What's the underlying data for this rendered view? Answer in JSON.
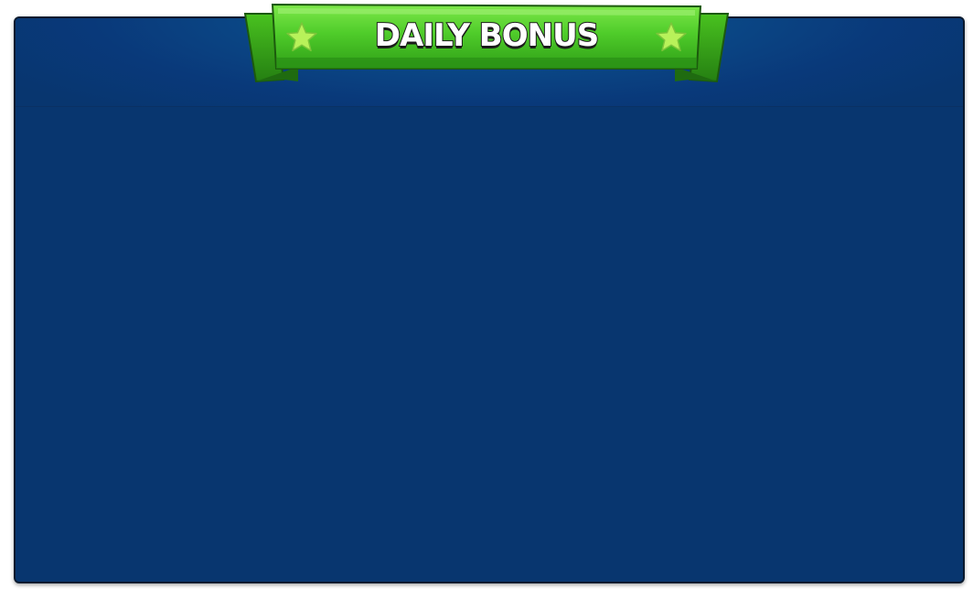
{
  "dialog": {
    "title": "DAILY BONUS"
  },
  "icons": {
    "left": "star-icon",
    "right": "star-icon"
  },
  "colors": {
    "panel_background": "#08366f",
    "ribbon_green": "#3cb51f",
    "star_yellow_green": "#b8f25a",
    "title_text": "#ffffff"
  }
}
